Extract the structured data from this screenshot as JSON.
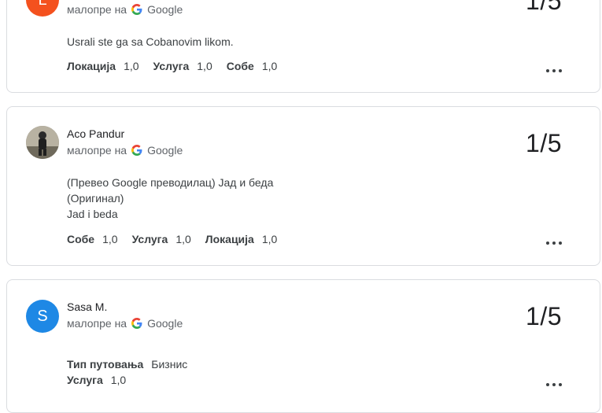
{
  "google_label": "Google",
  "reviews": [
    {
      "avatar_letter": "L",
      "avatar_color": "#f4511e",
      "time": "малопре на",
      "rating": "1/5",
      "text": "Usrali ste ga sa Cobanovim likom.",
      "attributes": [
        {
          "label": "Локација",
          "value": "1,0"
        },
        {
          "label": "Услуга",
          "value": "1,0"
        },
        {
          "label": "Собе",
          "value": "1,0"
        }
      ]
    },
    {
      "name": "Aco Pandur",
      "avatar_letter": "",
      "avatar_color": "#9e9e9e",
      "time": "малопре на",
      "rating": "1/5",
      "text_lines": [
        "(Превео Google преводилац) Јад и беда",
        "(Оригинал)",
        "Jad i beda"
      ],
      "attributes": [
        {
          "label": "Собе",
          "value": "1,0"
        },
        {
          "label": "Услуга",
          "value": "1,0"
        },
        {
          "label": "Локација",
          "value": "1,0"
        }
      ]
    },
    {
      "name": "Sasa M.",
      "avatar_letter": "S",
      "avatar_color": "#1e88e5",
      "time": "малопре на",
      "rating": "1/5",
      "attributes": [
        {
          "label": "Тип путовања",
          "value": "Бизнис"
        }
      ],
      "attributes_row2": [
        {
          "label": "Услуга",
          "value": "1,0"
        }
      ]
    }
  ]
}
